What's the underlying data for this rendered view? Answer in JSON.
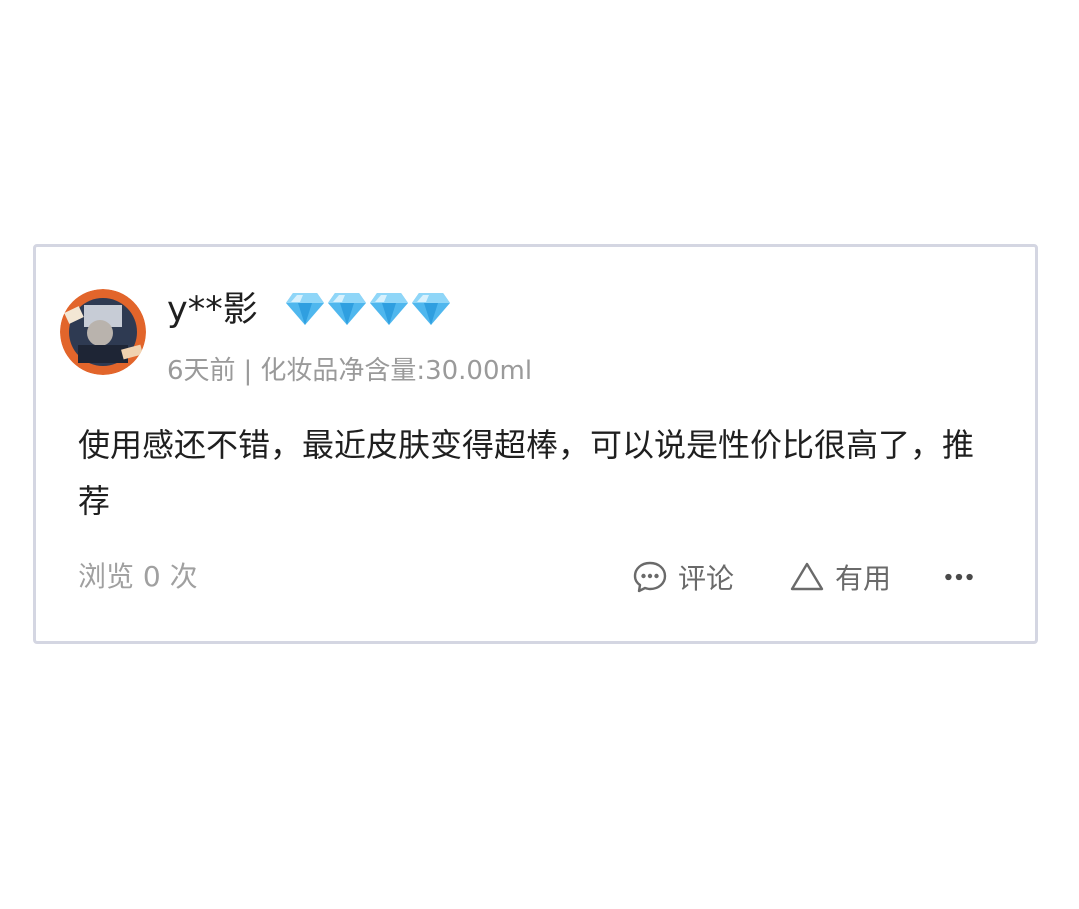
{
  "review": {
    "username": "y**影",
    "level_icon": "diamond-icon",
    "level_count": 4,
    "accent_color": "#4fb7ee",
    "time": "6天前",
    "separator": "|",
    "spec": "化妆品净含量:30.00ml",
    "content": "使用感还不错，最近皮肤变得超棒，可以说是性价比很高了，推荐",
    "views": "浏览 0 次"
  },
  "actions": {
    "comment_icon": "comment-bubble-icon",
    "comment_label": "评论",
    "useful_icon": "triangle-thumb-icon",
    "useful_label": "有用",
    "more_icon": "more-dots-icon"
  }
}
